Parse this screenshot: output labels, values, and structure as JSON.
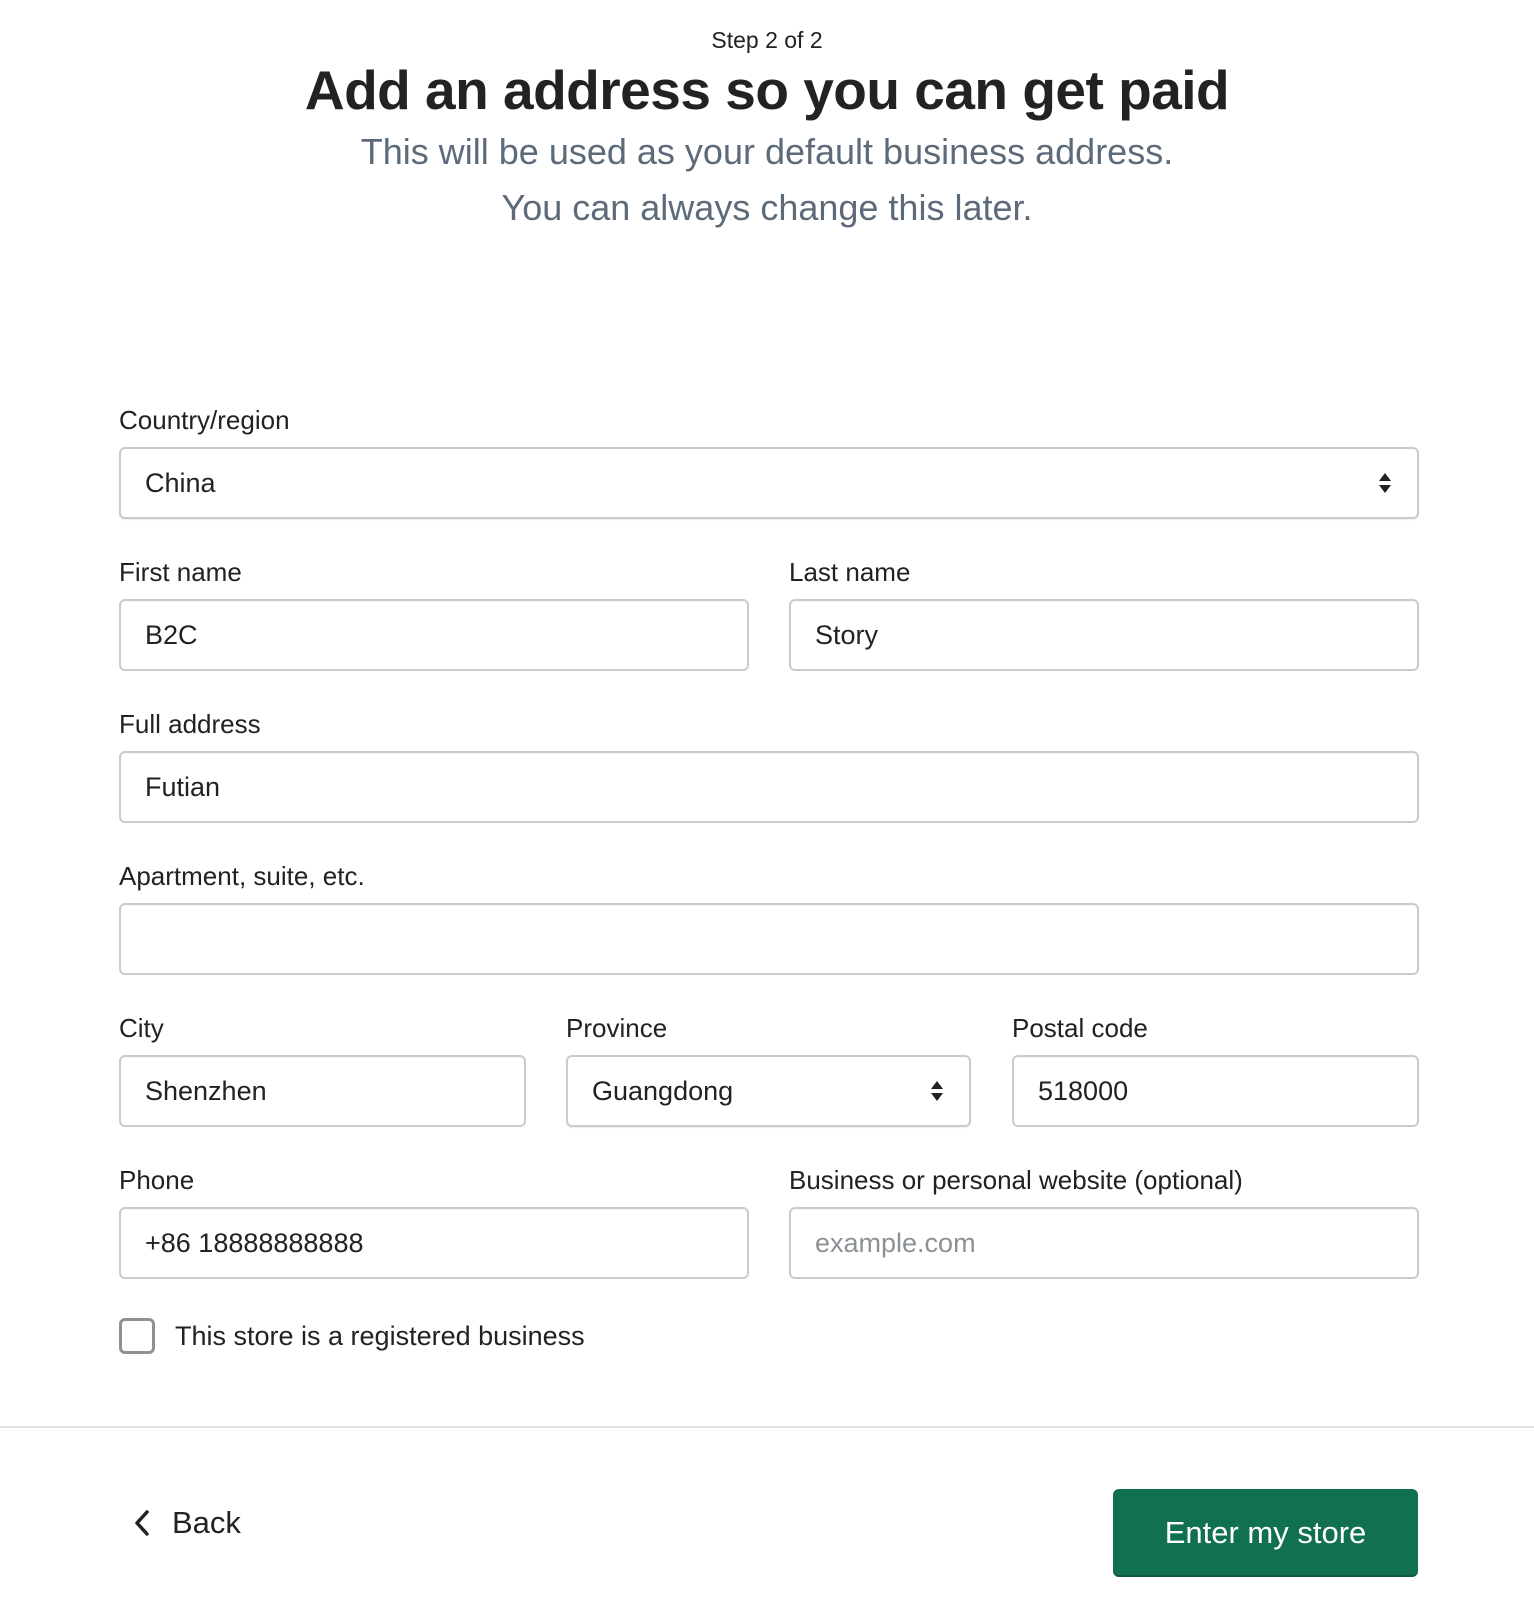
{
  "header": {
    "step": "Step 2 of 2",
    "title": "Add an address so you can get paid",
    "subtitle_line1": "This will be used as your default business address.",
    "subtitle_line2": "You can always change this later."
  },
  "form": {
    "country": {
      "label": "Country/region",
      "value": "China"
    },
    "first_name": {
      "label": "First name",
      "value": "B2C"
    },
    "last_name": {
      "label": "Last name",
      "value": "Story"
    },
    "address": {
      "label": "Full address",
      "value": "Futian"
    },
    "apartment": {
      "label": "Apartment, suite, etc.",
      "value": ""
    },
    "city": {
      "label": "City",
      "value": "Shenzhen"
    },
    "province": {
      "label": "Province",
      "value": "Guangdong"
    },
    "postal_code": {
      "label": "Postal code",
      "value": "518000"
    },
    "phone": {
      "label": "Phone",
      "value": "+86 18888888888"
    },
    "website": {
      "label": "Business or personal website (optional)",
      "value": "",
      "placeholder": "example.com"
    },
    "registered_business": {
      "label": "This store is a registered business",
      "checked": false
    }
  },
  "footer": {
    "back_label": "Back",
    "submit_label": "Enter my store"
  },
  "colors": {
    "primary": "#10704f",
    "subtitle_text": "#5c6a7a",
    "border": "#c9cccf"
  },
  "icons": {
    "select_arrow": "updown-arrows-icon",
    "back": "chevron-left-icon"
  }
}
